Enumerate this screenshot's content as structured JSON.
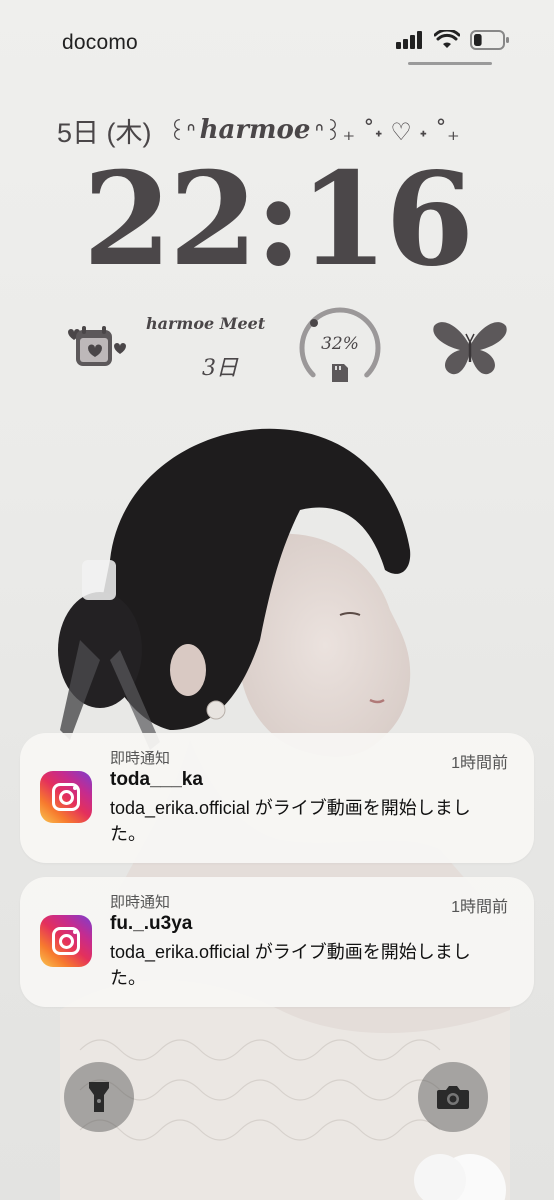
{
  "status_bar": {
    "carrier": "docomo",
    "battery_level": 0.28,
    "icons": [
      "signal-icon",
      "wifi-icon",
      "battery-icon"
    ]
  },
  "lock_screen": {
    "date": "5日 (木)",
    "deco_left": "꒰ᐢ",
    "deco_name": "harmoe",
    "deco_right": "ᐢ꒱₊ ˚˖ ♡ ˖ ˚₊",
    "time": "22:16"
  },
  "widgets": {
    "calendar": {
      "icon": "calendar-heart-icon"
    },
    "meet": {
      "title": "harmoe Meet",
      "days": "3日"
    },
    "battery_ring": {
      "percent_label": "32%",
      "level": 0.32,
      "icon": "sd-card-icon"
    },
    "butterfly": {
      "icon": "butterfly-icon"
    }
  },
  "notifications": [
    {
      "app_label": "即時通知",
      "time": "1時間前",
      "title": "toda___ka",
      "body": "toda_erika.official がライブ動画を開始しました。",
      "icon": "instagram-icon"
    },
    {
      "app_label": "即時通知",
      "time": "1時間前",
      "title": "fu._.u3ya",
      "body": "toda_erika.official がライブ動画を開始しました。",
      "icon": "instagram-icon"
    }
  ],
  "quick_actions": {
    "left": "flashlight-icon",
    "right": "camera-icon"
  },
  "colors": {
    "widget_gray": "#4a4648",
    "instagram_gradient": [
      "#f9c650",
      "#e4305c",
      "#7b3fcf"
    ]
  }
}
